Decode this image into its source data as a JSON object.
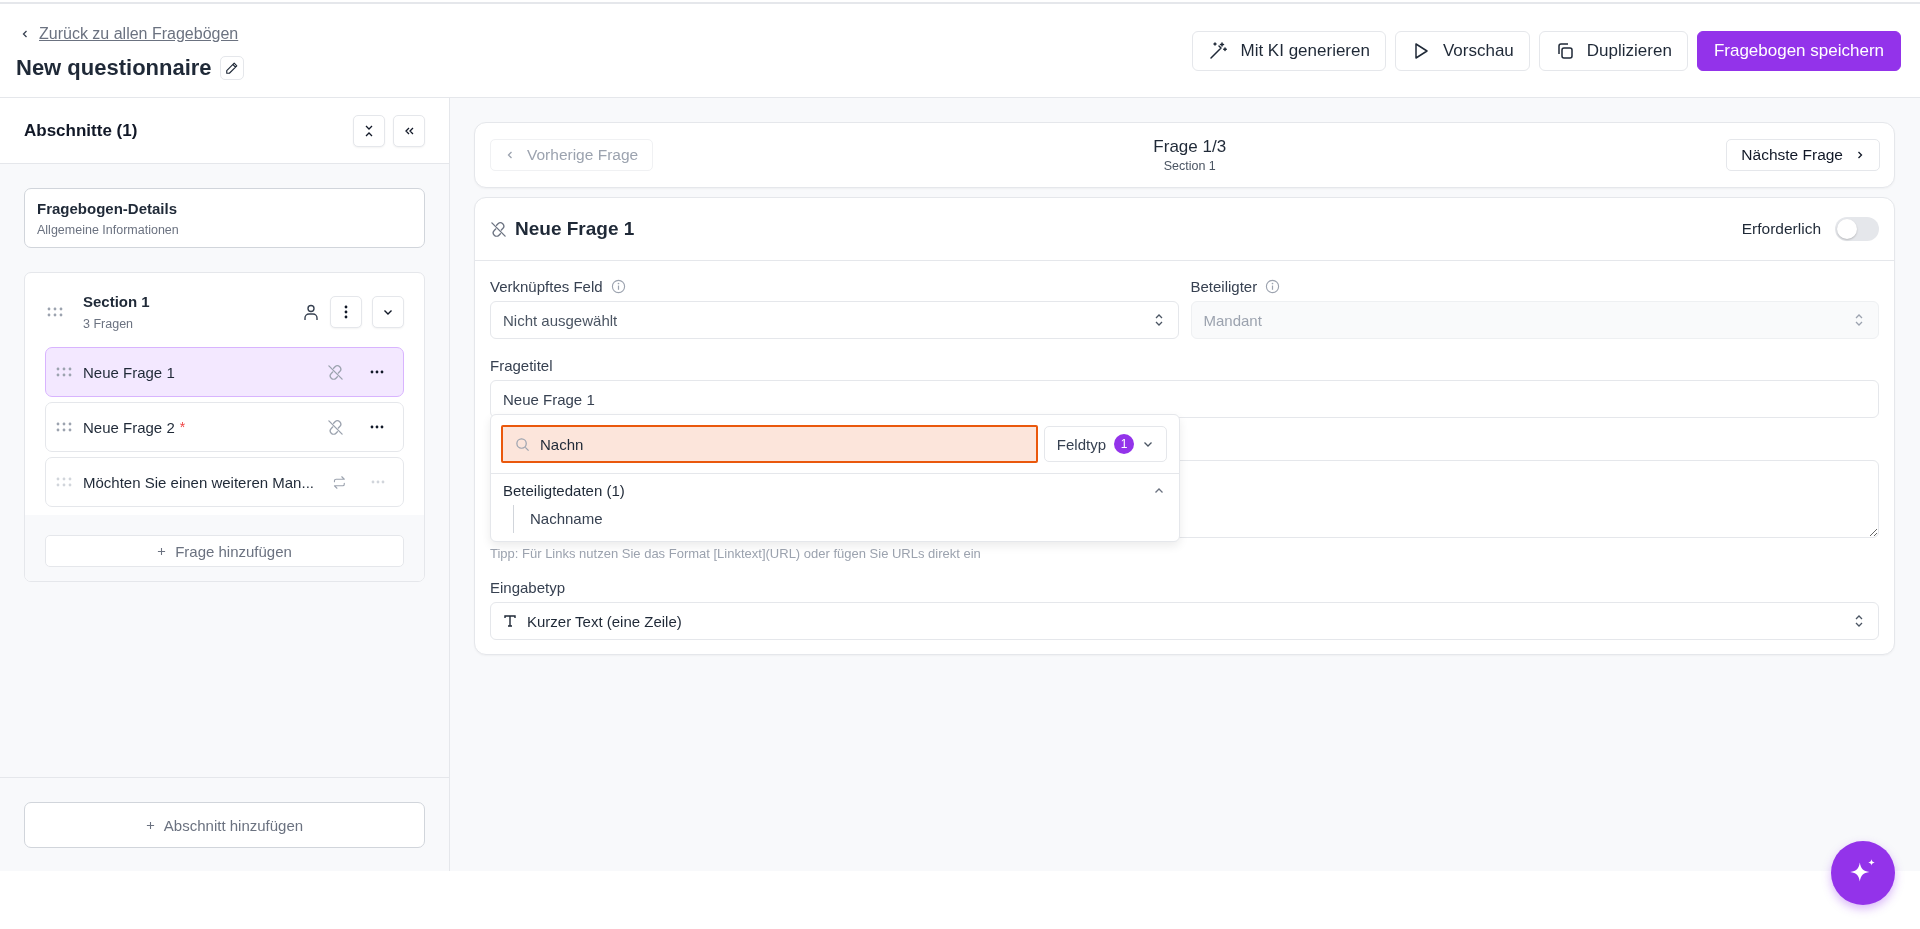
{
  "header": {
    "back_link": "Zurück zu allen Fragebögen",
    "title": "New questionnaire",
    "buttons": [
      {
        "label": "Mit KI generieren",
        "kind": "ai"
      },
      {
        "label": "Vorschau",
        "kind": "preview"
      },
      {
        "label": "Duplizieren",
        "kind": "duplicate"
      },
      {
        "label": "Fragebogen speichern",
        "kind": "primary"
      }
    ]
  },
  "sidebar": {
    "title": "Abschnitte (1)",
    "details": {
      "title": "Fragebogen-Details",
      "subtitle": "Allgemeine Informationen"
    },
    "sections": [
      {
        "title": "Section 1",
        "subtitle": "3 Fragen",
        "expanded": true,
        "add_question": "Frage hinzufügen",
        "questions": [
          {
            "label": "Neue Frage 1",
            "kind": "unlinked",
            "selected": true,
            "disabled": false
          },
          {
            "label": "Neue Frage 2",
            "required_mark": "*",
            "kind": "unlinked",
            "selected": false,
            "disabled": false
          },
          {
            "label": "Möchten Sie einen weiteren Man...",
            "kind": "repeat",
            "selected": false,
            "disabled": true
          }
        ]
      }
    ],
    "add_section": "Abschnitt hinzufügen"
  },
  "nav": {
    "previous": "Vorherige Frage",
    "previous_disabled": true,
    "counter": "Frage 1/3",
    "section": "Section 1",
    "next": "Nächste Frage"
  },
  "question": {
    "title": "Neue Frage 1",
    "required_label": "Erforderlich",
    "required": false,
    "linked_field": {
      "label": "Verknüpftes Feld",
      "value": "Nicht ausgewählt"
    },
    "participant": {
      "label": "Beteiligter",
      "value": "Mandant",
      "disabled": true
    },
    "title_field": {
      "label": "Fragetitel",
      "value": "Neue Frage 1"
    },
    "hint": "Tipp: Für Links nutzen Sie das Format [Linktext](URL) oder fügen Sie URLs direkt ein",
    "input_type": {
      "label": "Eingabetyp",
      "value": "Kurzer Text (eine Zeile)"
    }
  },
  "field_picker": {
    "search_value": "Nachn",
    "filter_label": "Feldtyp",
    "filter_count": "1",
    "groups": [
      {
        "title": "Beteiligtedaten (1)",
        "expanded": true,
        "items": [
          "Nachname"
        ]
      }
    ]
  }
}
